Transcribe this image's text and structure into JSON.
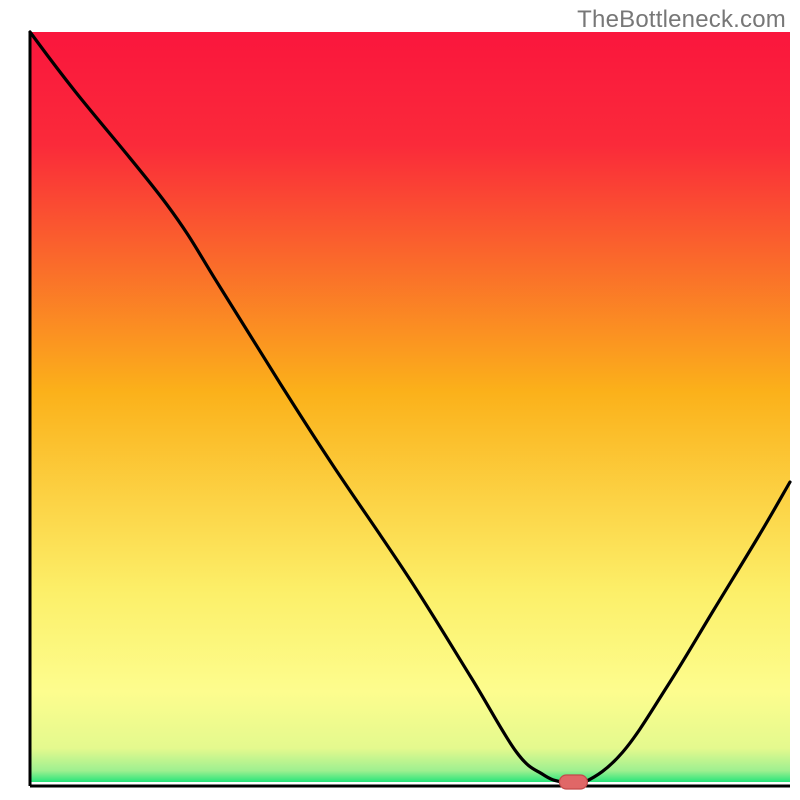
{
  "watermark": "TheBottleneck.com",
  "colors": {
    "top_red": "#fa163d",
    "mid_orange": "#fbb11a",
    "low_yellow": "#fdfd8e",
    "green": "#28e57a",
    "curve": "#000000",
    "marker_fill": "#e06767",
    "marker_stroke": "#c34a4a",
    "axis": "#000000"
  },
  "chart_data": {
    "type": "line",
    "title": "",
    "xlabel": "",
    "ylabel": "",
    "xlim": [
      0,
      100
    ],
    "ylim": [
      0,
      100
    ],
    "grid": false,
    "legend": false,
    "series": [
      {
        "name": "bottleneck-curve",
        "x": [
          0,
          6,
          18,
          25,
          33,
          40,
          50,
          58,
          64,
          67.5,
          70,
          73,
          78,
          84,
          90,
          96,
          100
        ],
        "values": [
          100,
          92,
          77,
          66,
          53,
          42,
          27,
          14,
          4,
          1,
          0,
          0,
          4,
          13,
          23,
          33,
          40
        ]
      }
    ],
    "markers": [
      {
        "name": "optimal-point",
        "x": 71.5,
        "y": 0,
        "shape": "rounded-rect"
      }
    ],
    "background": {
      "type": "vertical-gradient",
      "stops": [
        {
          "at": 0.0,
          "color": "#fa163d"
        },
        {
          "at": 0.15,
          "color": "#fa2a3a"
        },
        {
          "at": 0.48,
          "color": "#fbb11a"
        },
        {
          "at": 0.75,
          "color": "#fcf06a"
        },
        {
          "at": 0.88,
          "color": "#fdfd8e"
        },
        {
          "at": 0.955,
          "color": "#e4f98e"
        },
        {
          "at": 0.985,
          "color": "#9ef090"
        },
        {
          "at": 1.0,
          "color": "#28e57a"
        }
      ],
      "note": "green band only at the very bottom; most of the field is red→orange→yellow"
    }
  }
}
